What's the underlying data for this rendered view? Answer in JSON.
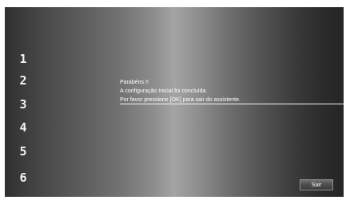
{
  "steps": [
    {
      "label": "1"
    },
    {
      "label": "2"
    },
    {
      "label": "3"
    },
    {
      "label": "4"
    },
    {
      "label": "5"
    },
    {
      "label": "6"
    }
  ],
  "message": {
    "line1": "Parabéns !!",
    "line2": "A configuração Inicial foi concluída.",
    "line3": "Por favor pressione [OK] para sair do assistente."
  },
  "button": {
    "exit_label": "Sair"
  }
}
